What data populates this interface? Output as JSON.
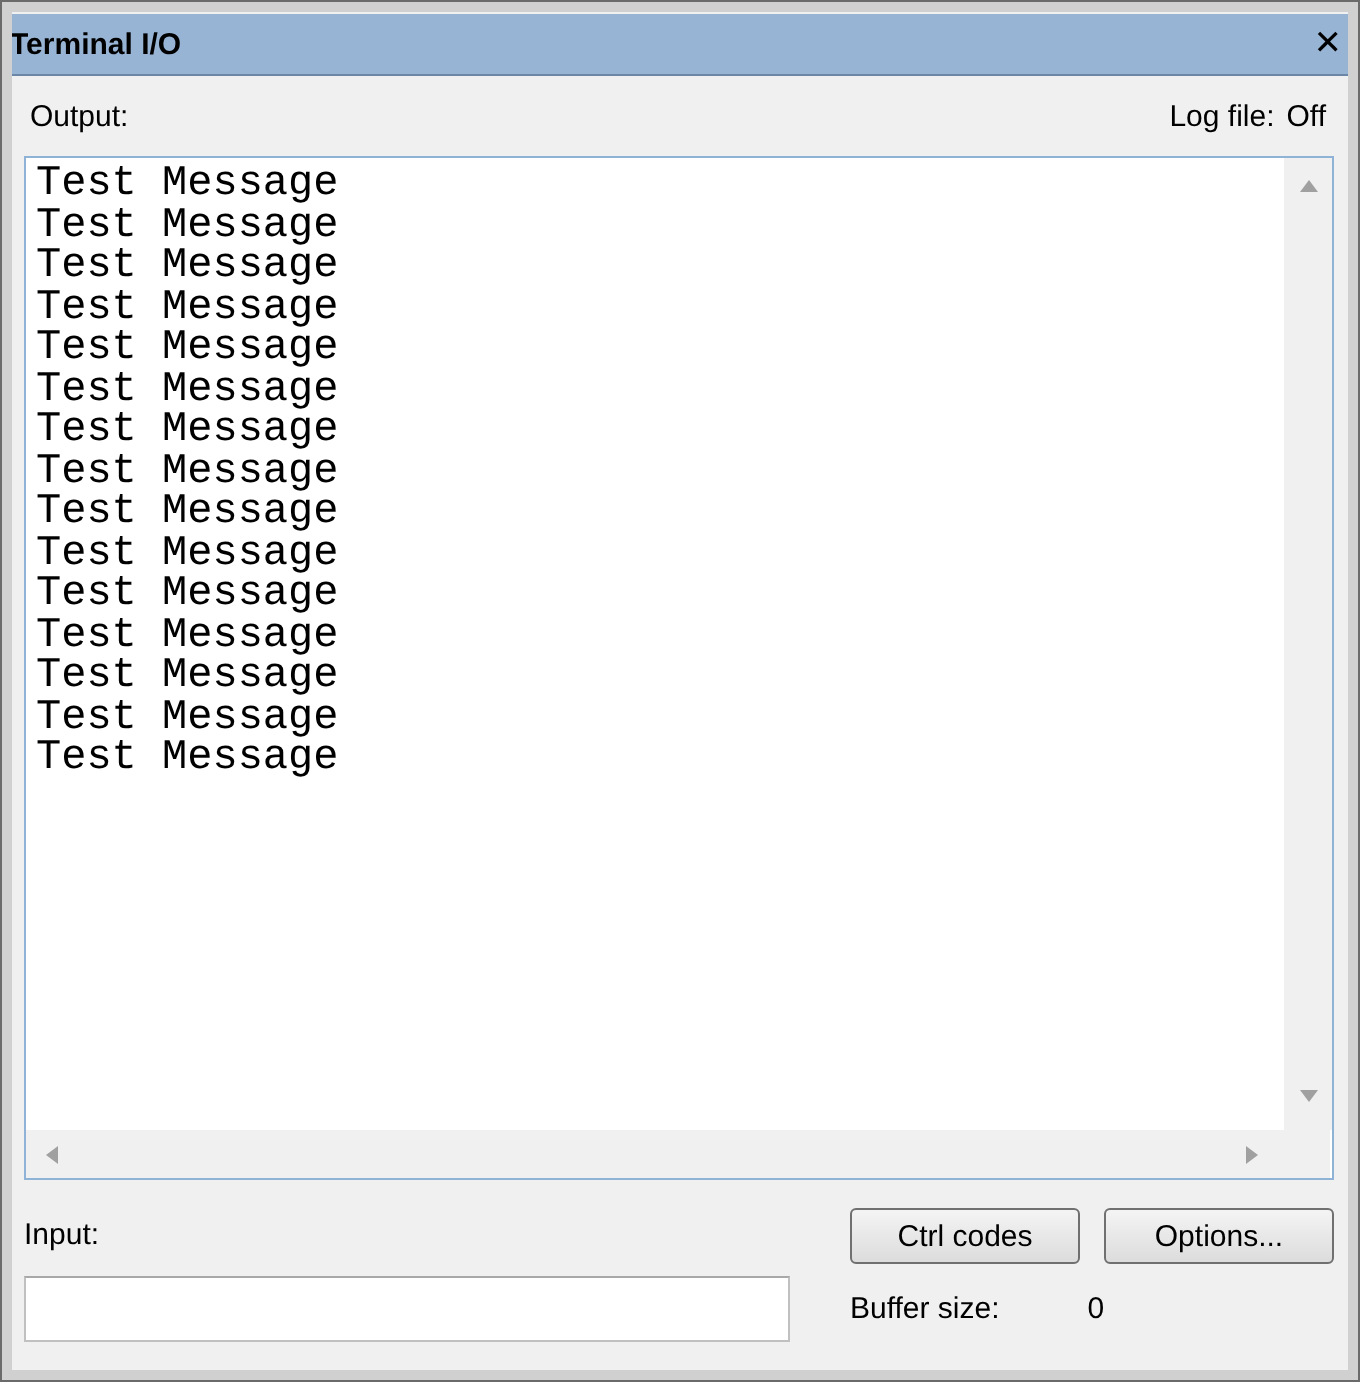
{
  "window": {
    "title": "Terminal I/O",
    "close": "✕"
  },
  "output": {
    "label": "Output:",
    "log_file_label": "Log file:",
    "log_file_value": "Off",
    "lines": [
      "Test Message",
      "Test Message",
      "Test Message",
      "Test Message",
      "Test Message",
      "Test Message",
      "Test Message",
      "Test Message",
      "Test Message",
      "Test Message",
      "Test Message",
      "Test Message",
      "Test Message",
      "Test Message",
      "Test Message"
    ]
  },
  "input": {
    "label": "Input:"
  },
  "buttons": [
    {
      "label": "Ctrl codes"
    },
    {
      "label": "Options..."
    }
  ],
  "buffer": {
    "label": "Buffer size:",
    "value": "0"
  }
}
